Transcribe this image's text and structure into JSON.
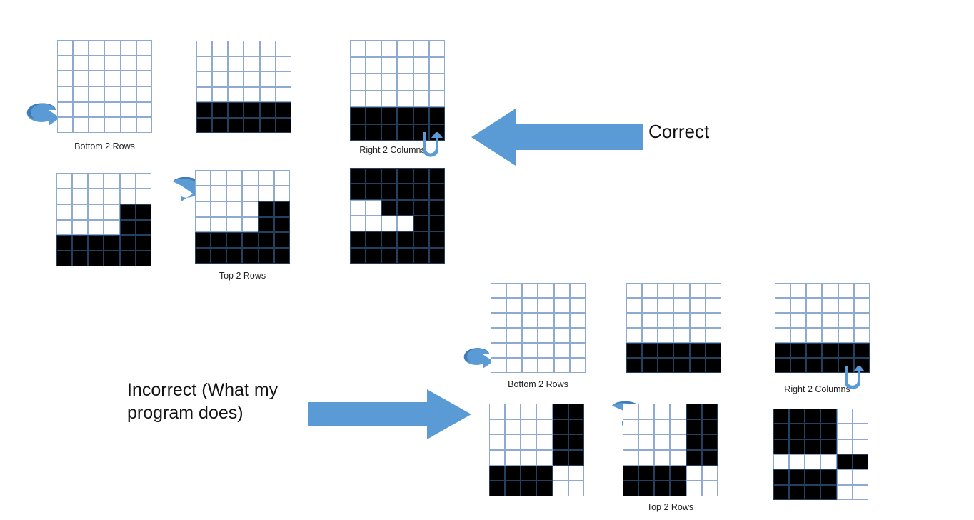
{
  "figure": {
    "title": "Matrix rotation step diagram",
    "colors": {
      "arrow_blue": "#5B9BD5",
      "arrow_blue_dark": "#3F7CB5",
      "grid_line": "#8FAAD0",
      "filled_cell": "#000000",
      "text": "#222222",
      "background": "#FFFFFF"
    }
  },
  "annotations": {
    "correct": "Correct",
    "incorrect": "Incorrect (What my\nprogram does)"
  },
  "labels": {
    "bottom_2_rows": "Bottom 2 Rows",
    "top_2_rows": "Top 2 Rows",
    "right_2_columns": "Right 2 Columns"
  },
  "icons": {
    "rotate": "rotate-arrow-icon",
    "arrow_left": "block-arrow-left-icon",
    "arrow_right": "block-arrow-right-icon",
    "arrow_up_curved": "curved-arrow-up-icon"
  },
  "grids": {
    "rows": 6,
    "cols": 6,
    "correct": {
      "step1": {
        "name": "correct-grid-empty",
        "cells": [
          [
            0,
            0,
            0,
            0,
            0,
            0
          ],
          [
            0,
            0,
            0,
            0,
            0,
            0
          ],
          [
            0,
            0,
            0,
            0,
            0,
            0
          ],
          [
            0,
            0,
            0,
            0,
            0,
            0
          ],
          [
            0,
            0,
            0,
            0,
            0,
            0
          ],
          [
            0,
            0,
            0,
            0,
            0,
            0
          ]
        ]
      },
      "step2": {
        "name": "correct-grid-bottom-rows-filled",
        "cells": [
          [
            0,
            0,
            0,
            0,
            0,
            0
          ],
          [
            0,
            0,
            0,
            0,
            0,
            0
          ],
          [
            0,
            0,
            0,
            0,
            0,
            0
          ],
          [
            0,
            0,
            0,
            0,
            0,
            0
          ],
          [
            1,
            1,
            1,
            1,
            1,
            1
          ],
          [
            1,
            1,
            1,
            1,
            1,
            1
          ]
        ]
      },
      "step3": {
        "name": "correct-grid-right-columns",
        "cells": [
          [
            0,
            0,
            0,
            0,
            0,
            0
          ],
          [
            0,
            0,
            0,
            0,
            0,
            0
          ],
          [
            0,
            0,
            0,
            0,
            0,
            0
          ],
          [
            0,
            0,
            0,
            0,
            0,
            0
          ],
          [
            1,
            1,
            1,
            1,
            1,
            1
          ],
          [
            1,
            1,
            1,
            1,
            1,
            1
          ]
        ]
      },
      "step4": {
        "name": "correct-grid-stair-left",
        "cells": [
          [
            0,
            0,
            0,
            0,
            0,
            0
          ],
          [
            0,
            0,
            0,
            0,
            0,
            0
          ],
          [
            0,
            0,
            0,
            0,
            1,
            1
          ],
          [
            0,
            0,
            0,
            0,
            1,
            1
          ],
          [
            1,
            1,
            1,
            1,
            1,
            1
          ],
          [
            1,
            1,
            1,
            1,
            1,
            1
          ]
        ]
      },
      "step5": {
        "name": "correct-grid-stair-middle",
        "cells": [
          [
            0,
            0,
            0,
            0,
            0,
            0
          ],
          [
            0,
            0,
            0,
            0,
            0,
            0
          ],
          [
            0,
            0,
            0,
            0,
            1,
            1
          ],
          [
            0,
            0,
            0,
            0,
            1,
            1
          ],
          [
            1,
            1,
            1,
            1,
            1,
            1
          ],
          [
            1,
            1,
            1,
            1,
            1,
            1
          ]
        ]
      },
      "step6": {
        "name": "correct-grid-result",
        "cells": [
          [
            1,
            1,
            1,
            1,
            1,
            1
          ],
          [
            1,
            1,
            1,
            1,
            1,
            1
          ],
          [
            0,
            0,
            1,
            1,
            1,
            1
          ],
          [
            0,
            0,
            0,
            0,
            1,
            1
          ],
          [
            1,
            1,
            1,
            1,
            1,
            1
          ],
          [
            1,
            1,
            1,
            1,
            1,
            1
          ]
        ]
      }
    },
    "incorrect": {
      "step1": {
        "name": "incorrect-grid-empty",
        "cells": [
          [
            0,
            0,
            0,
            0,
            0,
            0
          ],
          [
            0,
            0,
            0,
            0,
            0,
            0
          ],
          [
            0,
            0,
            0,
            0,
            0,
            0
          ],
          [
            0,
            0,
            0,
            0,
            0,
            0
          ],
          [
            0,
            0,
            0,
            0,
            0,
            0
          ],
          [
            0,
            0,
            0,
            0,
            0,
            0
          ]
        ]
      },
      "step2": {
        "name": "incorrect-grid-bottom-rows-filled",
        "cells": [
          [
            0,
            0,
            0,
            0,
            0,
            0
          ],
          [
            0,
            0,
            0,
            0,
            0,
            0
          ],
          [
            0,
            0,
            0,
            0,
            0,
            0
          ],
          [
            0,
            0,
            0,
            0,
            0,
            0
          ],
          [
            1,
            1,
            1,
            1,
            1,
            1
          ],
          [
            1,
            1,
            1,
            1,
            1,
            1
          ]
        ]
      },
      "step3": {
        "name": "incorrect-grid-right-columns",
        "cells": [
          [
            0,
            0,
            0,
            0,
            0,
            0
          ],
          [
            0,
            0,
            0,
            0,
            0,
            0
          ],
          [
            0,
            0,
            0,
            0,
            0,
            0
          ],
          [
            0,
            0,
            0,
            0,
            0,
            0
          ],
          [
            1,
            1,
            1,
            1,
            1,
            1
          ],
          [
            1,
            1,
            1,
            1,
            1,
            1
          ]
        ]
      },
      "step4": {
        "name": "incorrect-grid-right-block-left",
        "cells": [
          [
            0,
            0,
            0,
            0,
            1,
            1
          ],
          [
            0,
            0,
            0,
            0,
            1,
            1
          ],
          [
            0,
            0,
            0,
            0,
            1,
            1
          ],
          [
            0,
            0,
            0,
            0,
            1,
            1
          ],
          [
            1,
            1,
            1,
            1,
            0,
            0
          ],
          [
            1,
            1,
            1,
            1,
            0,
            0
          ]
        ]
      },
      "step5": {
        "name": "incorrect-grid-right-block-middle",
        "cells": [
          [
            0,
            0,
            0,
            0,
            1,
            1
          ],
          [
            0,
            0,
            0,
            0,
            1,
            1
          ],
          [
            0,
            0,
            0,
            0,
            1,
            1
          ],
          [
            0,
            0,
            0,
            0,
            1,
            1
          ],
          [
            1,
            1,
            1,
            1,
            0,
            0
          ],
          [
            1,
            1,
            1,
            1,
            0,
            0
          ]
        ]
      },
      "step6": {
        "name": "incorrect-grid-result",
        "cells": [
          [
            1,
            1,
            1,
            1,
            0,
            0
          ],
          [
            1,
            1,
            1,
            1,
            0,
            0
          ],
          [
            1,
            1,
            1,
            1,
            0,
            0
          ],
          [
            0,
            0,
            0,
            0,
            1,
            1
          ],
          [
            1,
            1,
            1,
            1,
            0,
            0
          ],
          [
            1,
            1,
            1,
            1,
            0,
            0
          ]
        ]
      }
    }
  }
}
